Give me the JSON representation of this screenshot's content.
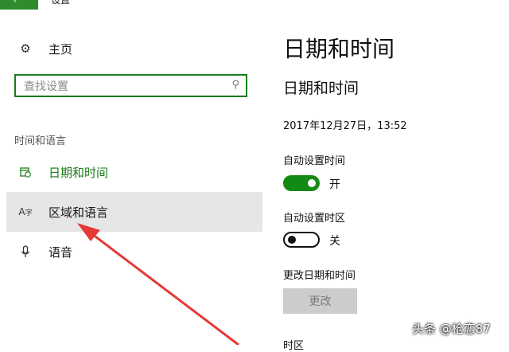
{
  "window": {
    "title": "设置"
  },
  "sidebar": {
    "home_label": "主页",
    "search_placeholder": "查找设置",
    "section_title": "时间和语言",
    "items": [
      {
        "label": "日期和时间",
        "icon": "calendar-clock-icon",
        "selected": true
      },
      {
        "label": "区域和语言",
        "icon": "language-icon",
        "hovered": true
      },
      {
        "label": "语音",
        "icon": "microphone-icon"
      }
    ]
  },
  "main": {
    "page_title": "日期和时间",
    "section_title": "日期和时间",
    "current_datetime": "2017年12月27日，13:52",
    "auto_time": {
      "label": "自动设置时间",
      "state_label": "开",
      "on": true
    },
    "auto_timezone": {
      "label": "自动设置时区",
      "state_label": "关",
      "on": false
    },
    "change": {
      "label": "更改日期和时间",
      "button_label": "更改"
    },
    "timezone_label": "时区"
  },
  "watermark": "头条 @枪恋87",
  "colors": {
    "accent": "#1a7d1a",
    "toggle_on": "#138a13",
    "annotation_arrow": "#e53935"
  }
}
